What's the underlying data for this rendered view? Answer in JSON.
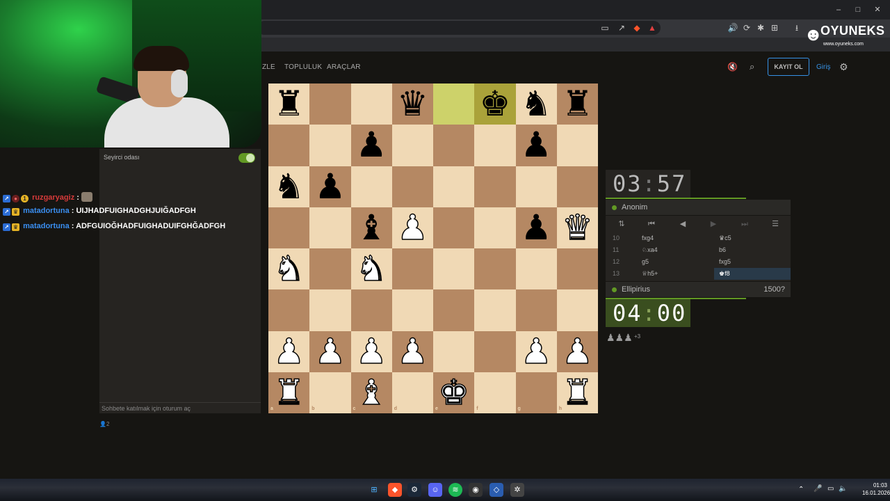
{
  "browser": {
    "window_controls": [
      "–",
      "□",
      "✕"
    ],
    "extension_icons": [
      "🔊",
      "⟳",
      "✱",
      "⊞",
      "⬡",
      "⭳"
    ]
  },
  "site": {
    "nav": [
      "İZLE",
      "TOPLULUK",
      "ARAÇLAR"
    ],
    "signup_label": "KAYIT OL",
    "login_label": "Giriş"
  },
  "chat": {
    "title": "Seyirci odası",
    "messages": [
      {
        "user": "ruzgaryagiz",
        "sep": " :",
        "text": ""
      },
      {
        "user": "matadortuna",
        "sep": " : ",
        "text": "UIJHADFUIGHADGHJUIĞADFGH"
      },
      {
        "user": "matadortuna",
        "sep": " : ",
        "text": "ADFGUIOĞHADFUIGHADUIFGHĞADFGH"
      }
    ],
    "badge_one": "1",
    "input_placeholder": "Sohbete katılmak için oturum aç",
    "viewers": "2"
  },
  "board": {
    "files": [
      "a",
      "b",
      "c",
      "d",
      "e",
      "f",
      "g",
      "h"
    ],
    "ranks": [
      "8",
      "7",
      "6",
      "5",
      "4",
      "3",
      "2",
      "1"
    ],
    "position": [
      [
        "r",
        "",
        "",
        "q",
        "",
        "k",
        "n",
        "r"
      ],
      [
        "",
        "",
        "p",
        "",
        "",
        "",
        "p",
        ""
      ],
      [
        "n",
        "p",
        "",
        "",
        "",
        "",
        "",
        ""
      ],
      [
        "",
        "",
        "b",
        "P",
        "",
        "",
        "p",
        "Q"
      ],
      [
        "N",
        "",
        "N",
        "",
        "",
        "",
        "",
        ""
      ],
      [
        "",
        "",
        "",
        "",
        "",
        "",
        "",
        ""
      ],
      [
        "P",
        "P",
        "P",
        "P",
        "",
        "",
        "P",
        "P"
      ],
      [
        "R",
        "",
        "B",
        "",
        "K",
        "",
        "",
        "R"
      ]
    ],
    "highlight": [
      "e8",
      "f8"
    ]
  },
  "game": {
    "top_player": {
      "name": "Anonim",
      "clock_min": "03",
      "clock_sec": "57"
    },
    "bottom_player": {
      "name": "Ellipirius",
      "rating": "1500?",
      "clock_min": "04",
      "clock_sec": "00"
    },
    "moves": [
      {
        "num": "10",
        "white": "fxg4",
        "black": "♛c5"
      },
      {
        "num": "11",
        "white": "♘xa4",
        "black": "b6"
      },
      {
        "num": "12",
        "white": "g5",
        "black": "fxg5"
      },
      {
        "num": "13",
        "white": "♕h5+",
        "black": "♚f8"
      }
    ],
    "captured": "♟♟♟",
    "material_diff": "+3"
  },
  "logo": {
    "name": "OYUNEKS",
    "url": "www.oyuneks.com"
  },
  "taskbar": {
    "time": "01:03",
    "date": "16.01.2026"
  }
}
